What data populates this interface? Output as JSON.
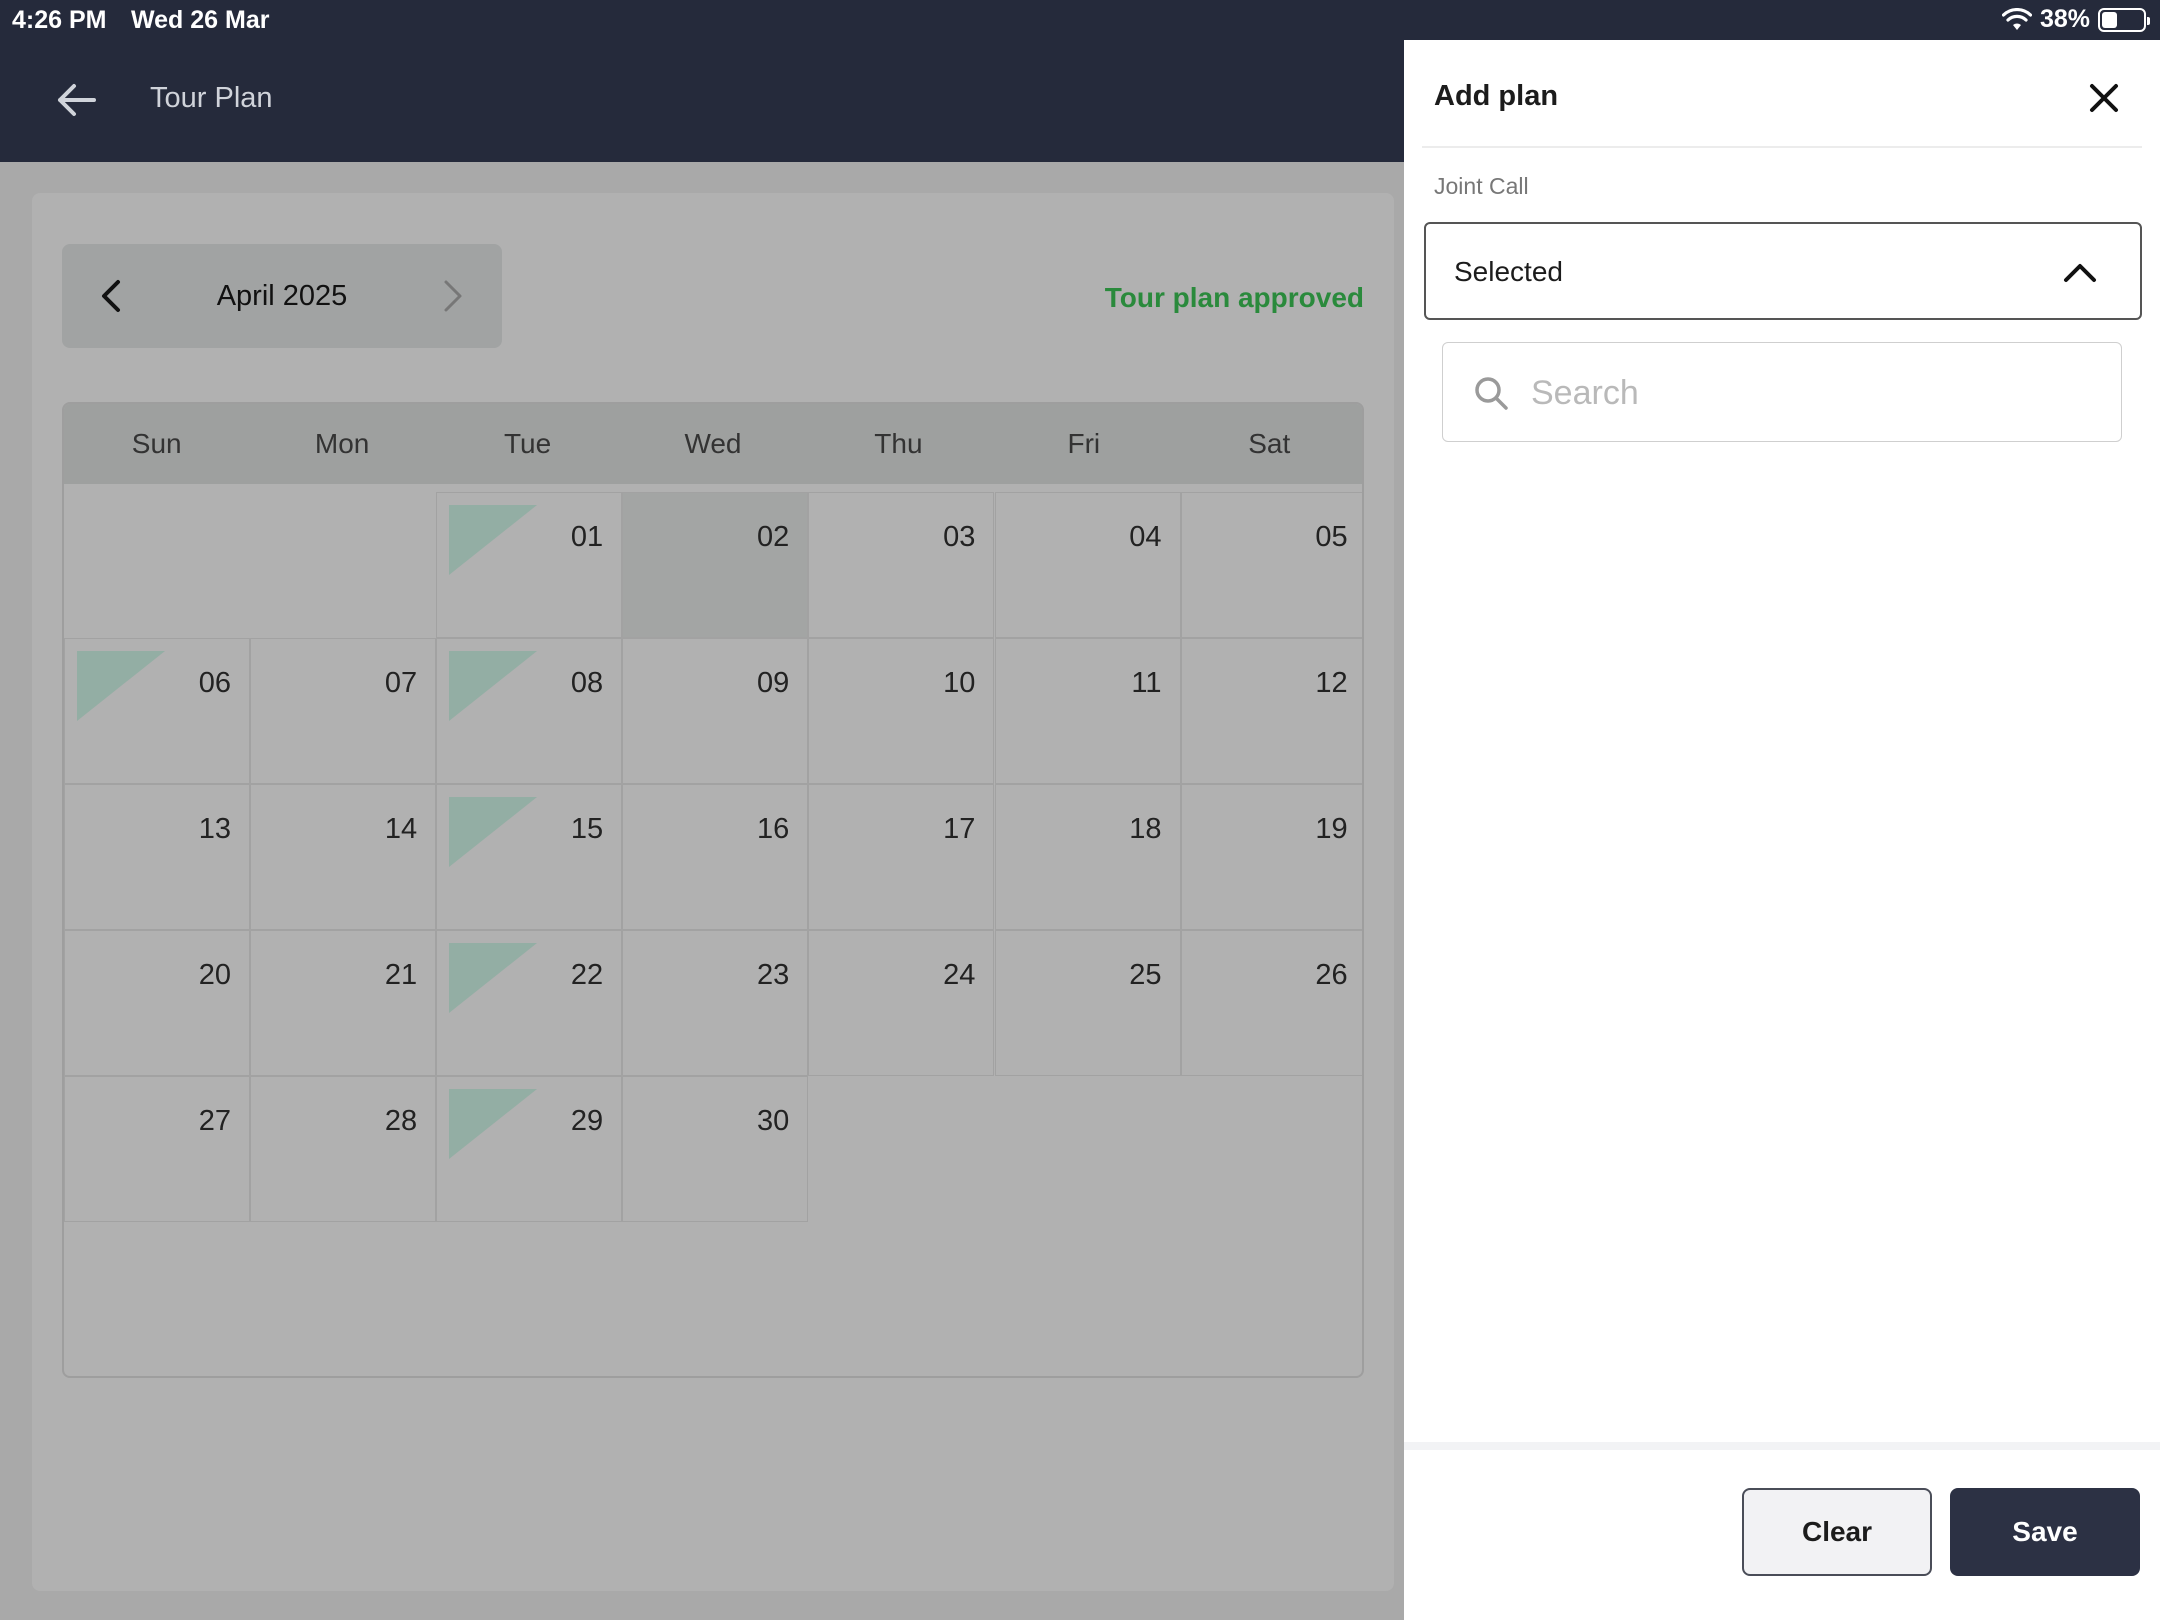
{
  "status_bar": {
    "time": "4:26 PM",
    "date": "Wed 26 Mar",
    "battery": "38%",
    "battery_level": 0.38
  },
  "header": {
    "title": "Tour Plan"
  },
  "calendar": {
    "month_label": "April 2025",
    "status": "Tour plan approved",
    "weekdays": [
      "Sun",
      "Mon",
      "Tue",
      "Wed",
      "Thu",
      "Fri",
      "Sat"
    ],
    "days": [
      {
        "label": "01",
        "col": 2,
        "row": 0,
        "marked": true
      },
      {
        "label": "02",
        "col": 3,
        "row": 0,
        "selected": true
      },
      {
        "label": "03",
        "col": 4,
        "row": 0
      },
      {
        "label": "04",
        "col": 5,
        "row": 0
      },
      {
        "label": "05",
        "col": 6,
        "row": 0
      },
      {
        "label": "06",
        "col": 0,
        "row": 1,
        "marked": true
      },
      {
        "label": "07",
        "col": 1,
        "row": 1
      },
      {
        "label": "08",
        "col": 2,
        "row": 1,
        "marked": true
      },
      {
        "label": "09",
        "col": 3,
        "row": 1
      },
      {
        "label": "10",
        "col": 4,
        "row": 1
      },
      {
        "label": "11",
        "col": 5,
        "row": 1
      },
      {
        "label": "12",
        "col": 6,
        "row": 1
      },
      {
        "label": "13",
        "col": 0,
        "row": 2
      },
      {
        "label": "14",
        "col": 1,
        "row": 2
      },
      {
        "label": "15",
        "col": 2,
        "row": 2,
        "marked": true
      },
      {
        "label": "16",
        "col": 3,
        "row": 2
      },
      {
        "label": "17",
        "col": 4,
        "row": 2
      },
      {
        "label": "18",
        "col": 5,
        "row": 2
      },
      {
        "label": "19",
        "col": 6,
        "row": 2
      },
      {
        "label": "20",
        "col": 0,
        "row": 3
      },
      {
        "label": "21",
        "col": 1,
        "row": 3
      },
      {
        "label": "22",
        "col": 2,
        "row": 3,
        "marked": true
      },
      {
        "label": "23",
        "col": 3,
        "row": 3
      },
      {
        "label": "24",
        "col": 4,
        "row": 3
      },
      {
        "label": "25",
        "col": 5,
        "row": 3
      },
      {
        "label": "26",
        "col": 6,
        "row": 3
      },
      {
        "label": "27",
        "col": 0,
        "row": 4
      },
      {
        "label": "28",
        "col": 1,
        "row": 4
      },
      {
        "label": "29",
        "col": 2,
        "row": 4,
        "marked": true
      },
      {
        "label": "30",
        "col": 3,
        "row": 4
      }
    ]
  },
  "panel": {
    "title": "Add plan",
    "field_label": "Joint Call",
    "select_value": "Selected",
    "search_placeholder": "Search",
    "clear_label": "Clear",
    "save_label": "Save"
  },
  "colors": {
    "header_bg": "#252a3b",
    "approved": "#2a8a3c",
    "marker": "#93aea4",
    "save_bg": "#2c3144"
  },
  "icons": [
    "back-arrow-icon",
    "chevron-left-icon",
    "chevron-right-icon",
    "close-icon",
    "chevron-up-icon",
    "search-icon",
    "wifi-icon",
    "battery-icon"
  ]
}
